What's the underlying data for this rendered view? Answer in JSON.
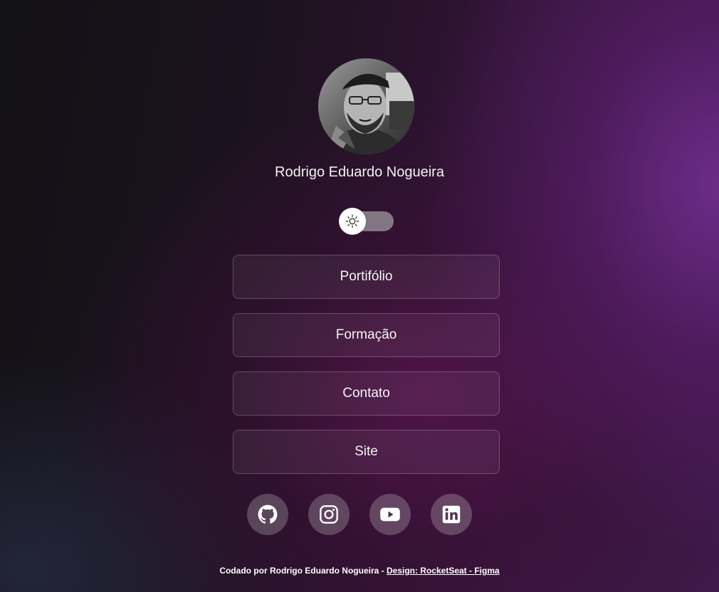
{
  "profile": {
    "name": "Rodrigo Eduardo Nogueira",
    "avatar_icon": "user-photo"
  },
  "theme_toggle": {
    "icon": "sun-icon",
    "state": "dark"
  },
  "links": [
    {
      "label": "Portifólio"
    },
    {
      "label": "Formação"
    },
    {
      "label": "Contato"
    },
    {
      "label": "Site"
    }
  ],
  "social": [
    {
      "icon": "github-icon"
    },
    {
      "icon": "instagram-icon"
    },
    {
      "icon": "youtube-icon"
    },
    {
      "icon": "linkedin-icon"
    }
  ],
  "footer": {
    "text": "Codado por Rodrigo Eduardo Nogueira - ",
    "link_text": "Design: RocketSeat - Figma"
  },
  "colors": {
    "accent": "#5b2270",
    "background_dark": "#121115"
  }
}
